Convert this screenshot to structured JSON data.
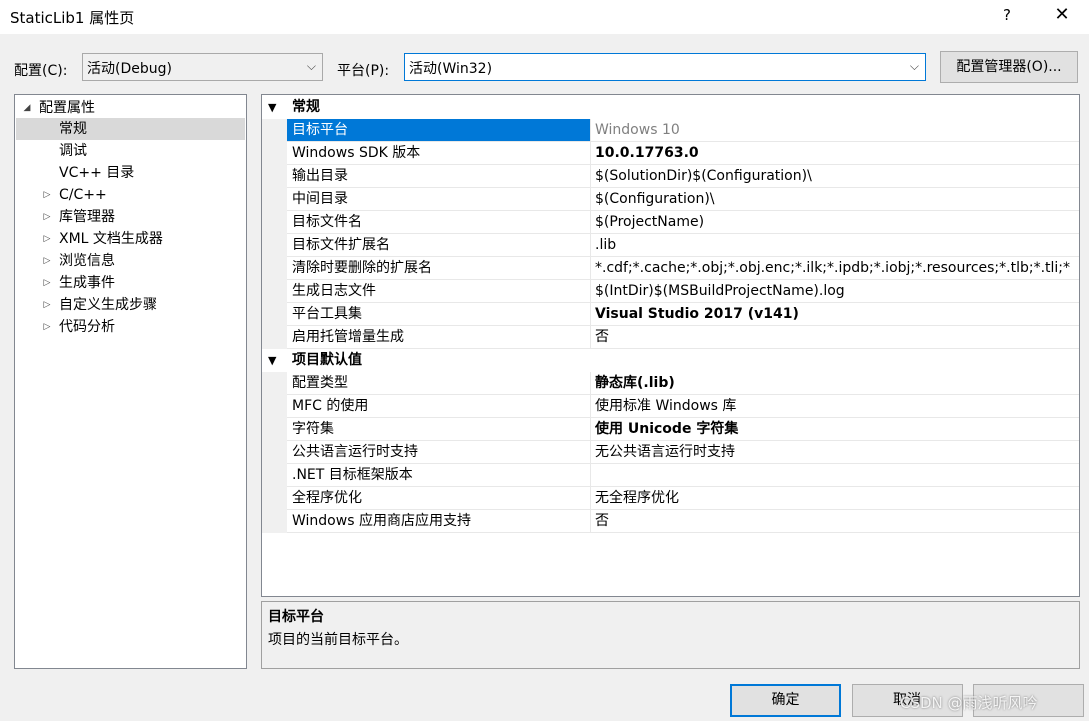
{
  "window": {
    "title": "StaticLib1 属性页",
    "help": "?",
    "close": "✕"
  },
  "config": {
    "config_label": "配置(C):",
    "config_value": "活动(Debug)",
    "platform_label": "平台(P):",
    "platform_value": "活动(Win32)",
    "manager_button": "配置管理器(O)..."
  },
  "tree": {
    "root": "配置属性",
    "items": [
      {
        "label": "常规",
        "expandable": false,
        "selected": true
      },
      {
        "label": "调试",
        "expandable": false
      },
      {
        "label": "VC++ 目录",
        "expandable": false
      },
      {
        "label": "C/C++",
        "expandable": true
      },
      {
        "label": "库管理器",
        "expandable": true
      },
      {
        "label": "XML 文档生成器",
        "expandable": true
      },
      {
        "label": "浏览信息",
        "expandable": true
      },
      {
        "label": "生成事件",
        "expandable": true
      },
      {
        "label": "自定义生成步骤",
        "expandable": true
      },
      {
        "label": "代码分析",
        "expandable": true
      }
    ]
  },
  "grid": {
    "cat1": "常规",
    "general": [
      {
        "name": "目标平台",
        "value": "Windows 10",
        "style": "dim",
        "selected": true
      },
      {
        "name": "Windows SDK 版本",
        "value": "10.0.17763.0",
        "style": "bold"
      },
      {
        "name": "输出目录",
        "value": "$(SolutionDir)$(Configuration)\\"
      },
      {
        "name": "中间目录",
        "value": "$(Configuration)\\"
      },
      {
        "name": "目标文件名",
        "value": "$(ProjectName)"
      },
      {
        "name": "目标文件扩展名",
        "value": ".lib"
      },
      {
        "name": "清除时要删除的扩展名",
        "value": "*.cdf;*.cache;*.obj;*.obj.enc;*.ilk;*.ipdb;*.iobj;*.resources;*.tlb;*.tli;*"
      },
      {
        "name": "生成日志文件",
        "value": "$(IntDir)$(MSBuildProjectName).log"
      },
      {
        "name": "平台工具集",
        "value": "Visual Studio 2017 (v141)",
        "style": "bold"
      },
      {
        "name": "启用托管增量生成",
        "value": "否"
      }
    ],
    "cat2": "项目默认值",
    "defaults": [
      {
        "name": "配置类型",
        "value": "静态库(.lib)",
        "style": "bold"
      },
      {
        "name": "MFC 的使用",
        "value": "使用标准 Windows 库"
      },
      {
        "name": "字符集",
        "value": "使用 Unicode 字符集",
        "style": "bold"
      },
      {
        "name": "公共语言运行时支持",
        "value": "无公共语言运行时支持"
      },
      {
        "name": ".NET 目标框架版本",
        "value": ""
      },
      {
        "name": "全程序优化",
        "value": "无全程序优化"
      },
      {
        "name": "Windows 应用商店应用支持",
        "value": "否"
      }
    ]
  },
  "description": {
    "title": "目标平台",
    "text": "项目的当前目标平台。"
  },
  "buttons": {
    "ok": "确定",
    "cancel": "取消",
    "apply": ""
  },
  "watermark": "CSDN @雨浅听风吟",
  "colors": {
    "accent": "#0078d7",
    "selection_row": "#d9d9d9"
  }
}
